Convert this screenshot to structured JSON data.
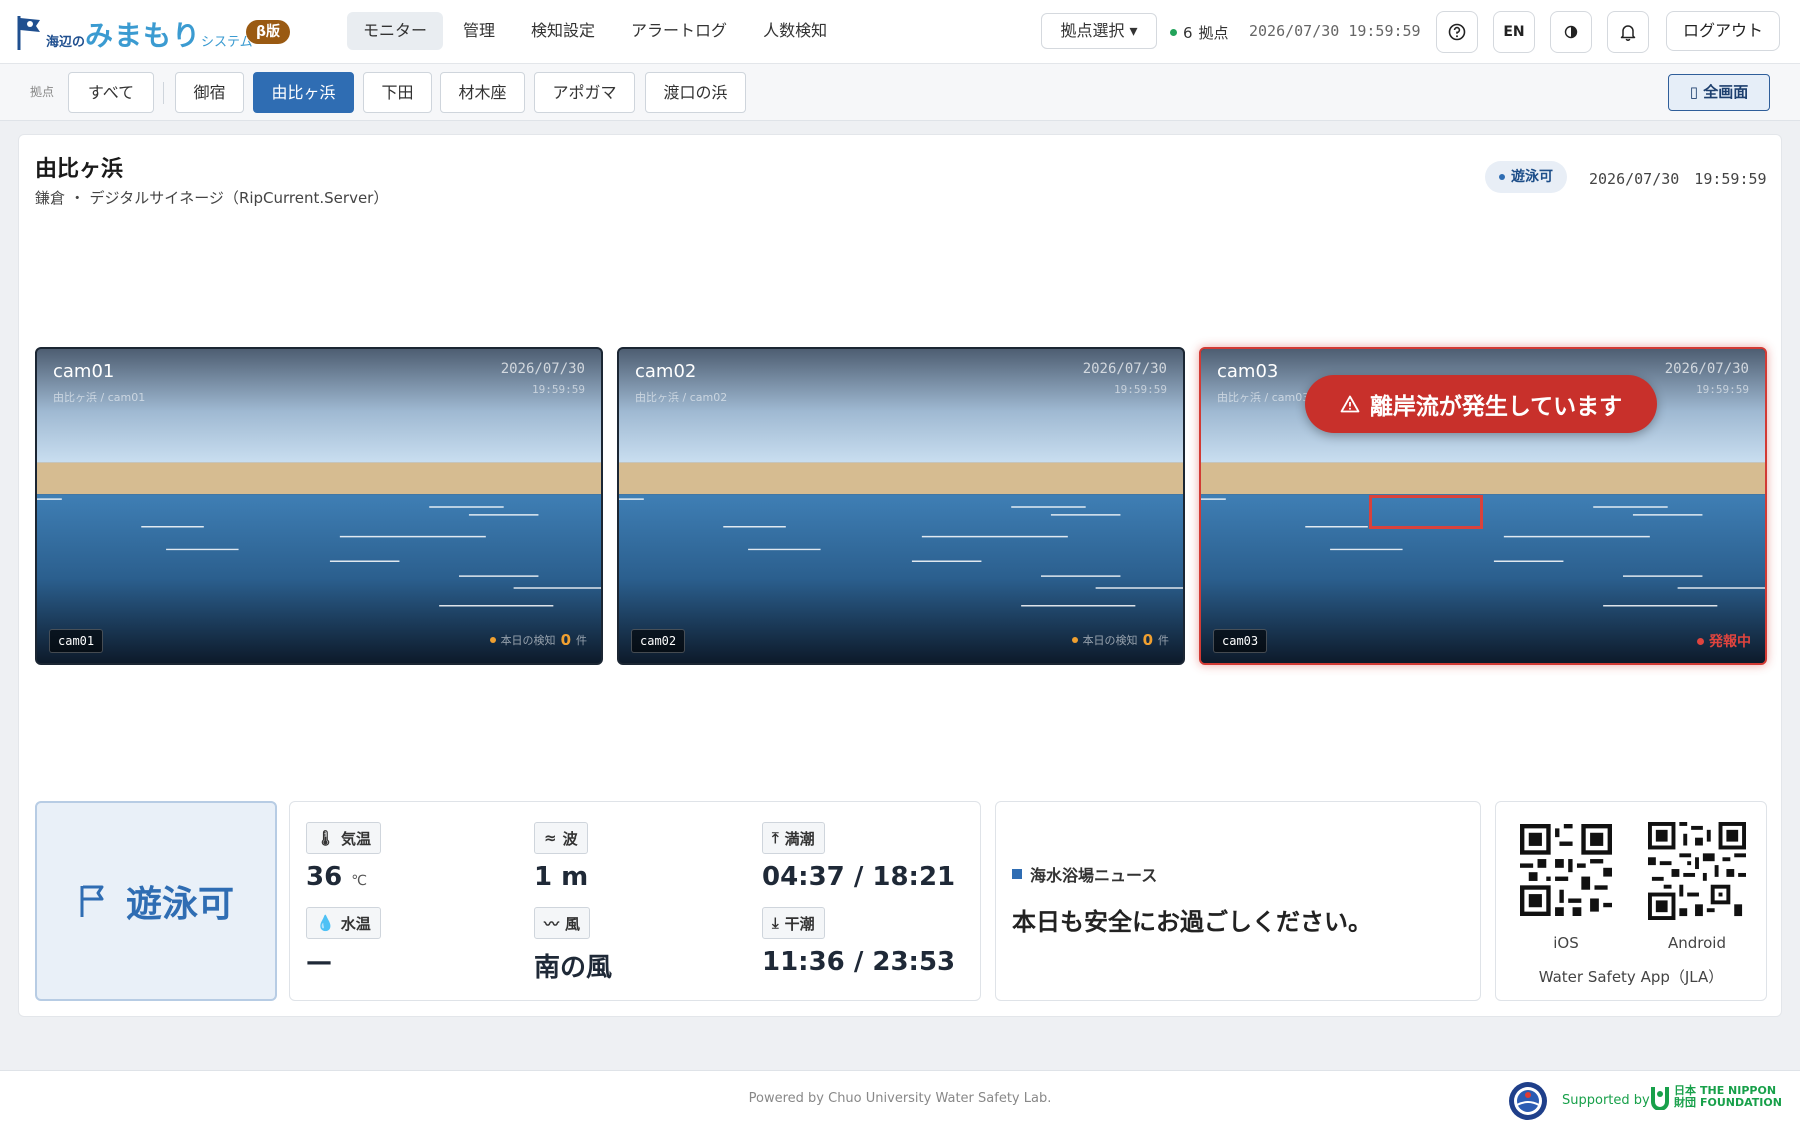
{
  "app": {
    "logo_small": "海辺の",
    "logo_main": "みまもり",
    "logo_suffix": "システム",
    "beta": "β版"
  },
  "nav": {
    "items": [
      {
        "label": "モニター",
        "active": true
      },
      {
        "label": "管理"
      },
      {
        "label": "検知設定"
      },
      {
        "label": "アラートログ"
      },
      {
        "label": "人数検知"
      }
    ]
  },
  "header": {
    "site_select": "拠点選択 ▾",
    "site_count": "6",
    "site_count_unit": "拠点",
    "clock": "2026/07/30 19:59:59",
    "help_icon": "help-icon",
    "lang_button": "EN",
    "theme_icon": "contrast-icon",
    "bell_icon": "bell-icon",
    "logout": "ログアウト"
  },
  "tabs": {
    "label": "拠点",
    "items": [
      "すべて",
      "御宿",
      "由比ヶ浜",
      "下田",
      "材木座",
      "アポガマ",
      "渡口の浜"
    ],
    "active": "由比ヶ浜",
    "fullscreen": "全画面"
  },
  "site": {
    "title": "由比ヶ浜",
    "subtitle": "鎌倉 ・ デジタルサイネージ（RipCurrent.Server）",
    "status_pill": "遊泳可",
    "clock": "2026/07/30　19:59:59"
  },
  "cameras": [
    {
      "name": "cam01",
      "path": "由比ヶ浜 / cam01",
      "date": "2026/07/30",
      "time": "19:59:59",
      "tag": "cam01",
      "count_label": "本日の検知",
      "count": "0",
      "count_unit": "件"
    },
    {
      "name": "cam02",
      "path": "由比ヶ浜 / cam02",
      "date": "2026/07/30",
      "time": "19:59:59",
      "tag": "cam02",
      "count_label": "本日の検知",
      "count": "0",
      "count_unit": "件"
    },
    {
      "name": "cam03",
      "path": "由比ヶ浜 / cam03",
      "date": "2026/07/30",
      "time": "19:59:59",
      "tag": "cam03",
      "alert_banner": "離岸流が発生しています",
      "alert_status": "発報中"
    }
  ],
  "status_card": {
    "label": "遊泳可",
    "icon": "flag-icon"
  },
  "weather": {
    "air_temp": {
      "label": "気温",
      "value": "36",
      "unit": "℃"
    },
    "wave": {
      "label": "波",
      "value": "1 m"
    },
    "high_tide": {
      "label": "満潮",
      "value": "04:37 / 18:21"
    },
    "water_temp": {
      "label": "水温",
      "value": "—"
    },
    "wind": {
      "label": "風",
      "value": "南の風"
    },
    "low_tide": {
      "label": "干潮",
      "value": "11:36 / 23:53"
    }
  },
  "news": {
    "title": "海水浴場ニュース",
    "body": "本日も安全にお過ごしください。"
  },
  "app_links": {
    "ios": "iOS",
    "android": "Android",
    "caption": "Water Safety App（JLA）"
  },
  "footer": {
    "powered": "Powered by Chuo University Water Safety Lab.",
    "supported": "Supported by",
    "nippon_jp": "日本\n財団",
    "nippon_en": "THE NIPPON\nFOUNDATION"
  },
  "colors": {
    "accent": "#2f6db3",
    "alert": "#c8302b",
    "beta": "#9a5a12",
    "ok_green": "#22a35a",
    "count_orange": "#f0a030"
  }
}
